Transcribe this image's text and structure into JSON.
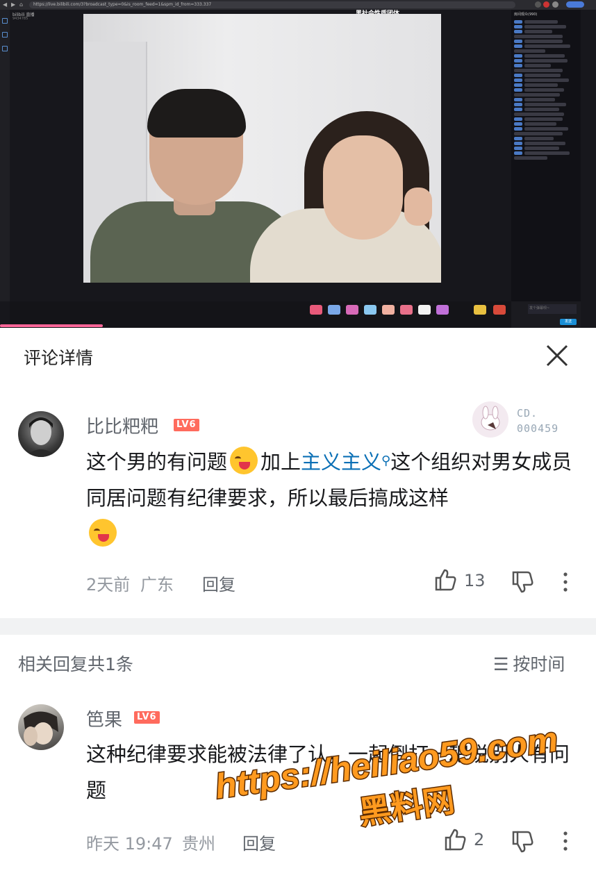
{
  "browser": {
    "url": "https://live.bilibili.com/3?broadcast_type=0&is_room_feed=1&spm_id_from=333.337"
  },
  "live": {
    "room_title": "bilibili 直播",
    "room_id": "9434785",
    "caption": "黑社会性质团体",
    "chat_header": "房间观众(990)",
    "input_placeholder": "发个弹幕呗~",
    "send_label": "发送"
  },
  "header": {
    "title": "评论详情"
  },
  "comment": {
    "username": "比比粑粑",
    "level": "LV6",
    "fan_id_line1": "CD.",
    "fan_id_line2": "000459",
    "text_a": "这个男的有问题",
    "text_b": "加上",
    "link": "主义主义",
    "text_c": "这个组织对男女成员同居问题有纪律要求，所以最后搞成这样",
    "time": "2天前",
    "location": "广东",
    "reply_label": "回复",
    "likes": "13"
  },
  "related": {
    "label": "相关回复共1条",
    "sort_label": "按时间"
  },
  "reply": {
    "username": "笆果",
    "level": "LV6",
    "text": "这种纪律要求能被法律了认，一起倒打一耙说别人有问题",
    "time": "昨天 19:47",
    "location": "贵州",
    "reply_label": "回复",
    "likes": "2"
  },
  "watermark": {
    "url": "https://heiliao59.com",
    "name": "黑料网"
  },
  "colors": {
    "level_badge": "#ff6b5d",
    "link": "#0a6fb5",
    "watermark_fill": "#ff9a1f"
  }
}
